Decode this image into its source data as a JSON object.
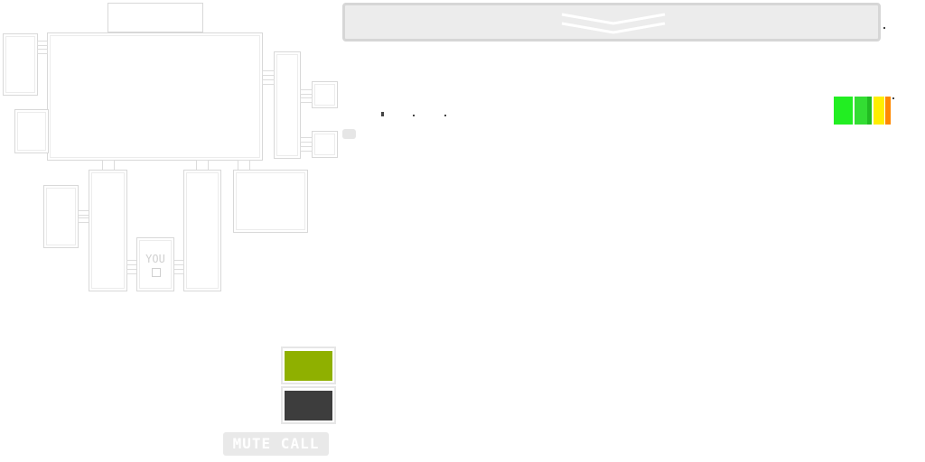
{
  "player": {
    "you_label": "YOU"
  },
  "controls": {
    "mute_label": "MUTE CALL",
    "swatch_colors": {
      "primary": "#8fb000",
      "secondary": "#3d3d3d"
    }
  },
  "top_bar": {
    "icon": "chevron-down-icon"
  },
  "signal_meter": {
    "colors": [
      "#22ee22",
      "#33dd33",
      "#22bb22",
      "#ffee00",
      "#ff8800"
    ]
  }
}
